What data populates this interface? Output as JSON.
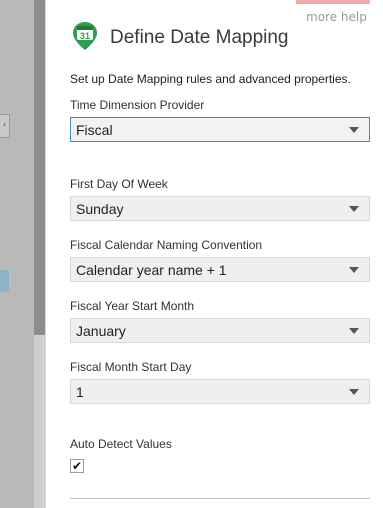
{
  "help": {
    "label": "more help"
  },
  "header": {
    "title": "Define Date Mapping",
    "icon": "calendar-pin-icon",
    "icon_day": "31"
  },
  "description": "Set up Date Mapping rules and advanced properties.",
  "fields": {
    "time_dimension_provider": {
      "label": "Time Dimension Provider",
      "value": "Fiscal"
    },
    "first_day_of_week": {
      "label": "First Day Of Week",
      "value": "Sunday"
    },
    "fiscal_naming": {
      "label": "Fiscal Calendar Naming Convention",
      "value": "Calendar year name + 1"
    },
    "fiscal_year_start_month": {
      "label": "Fiscal Year Start Month",
      "value": "January"
    },
    "fiscal_month_start_day": {
      "label": "Fiscal Month Start Day",
      "value": "1"
    }
  },
  "auto_detect": {
    "label": "Auto Detect Values",
    "checked": true,
    "check_glyph": "✔"
  },
  "background": {
    "edge_tab_glyph": "‹"
  },
  "colors": {
    "accent": "#f2a9a9",
    "icon_green": "#2e9e4f",
    "focus_border": "#3c8dc4"
  }
}
